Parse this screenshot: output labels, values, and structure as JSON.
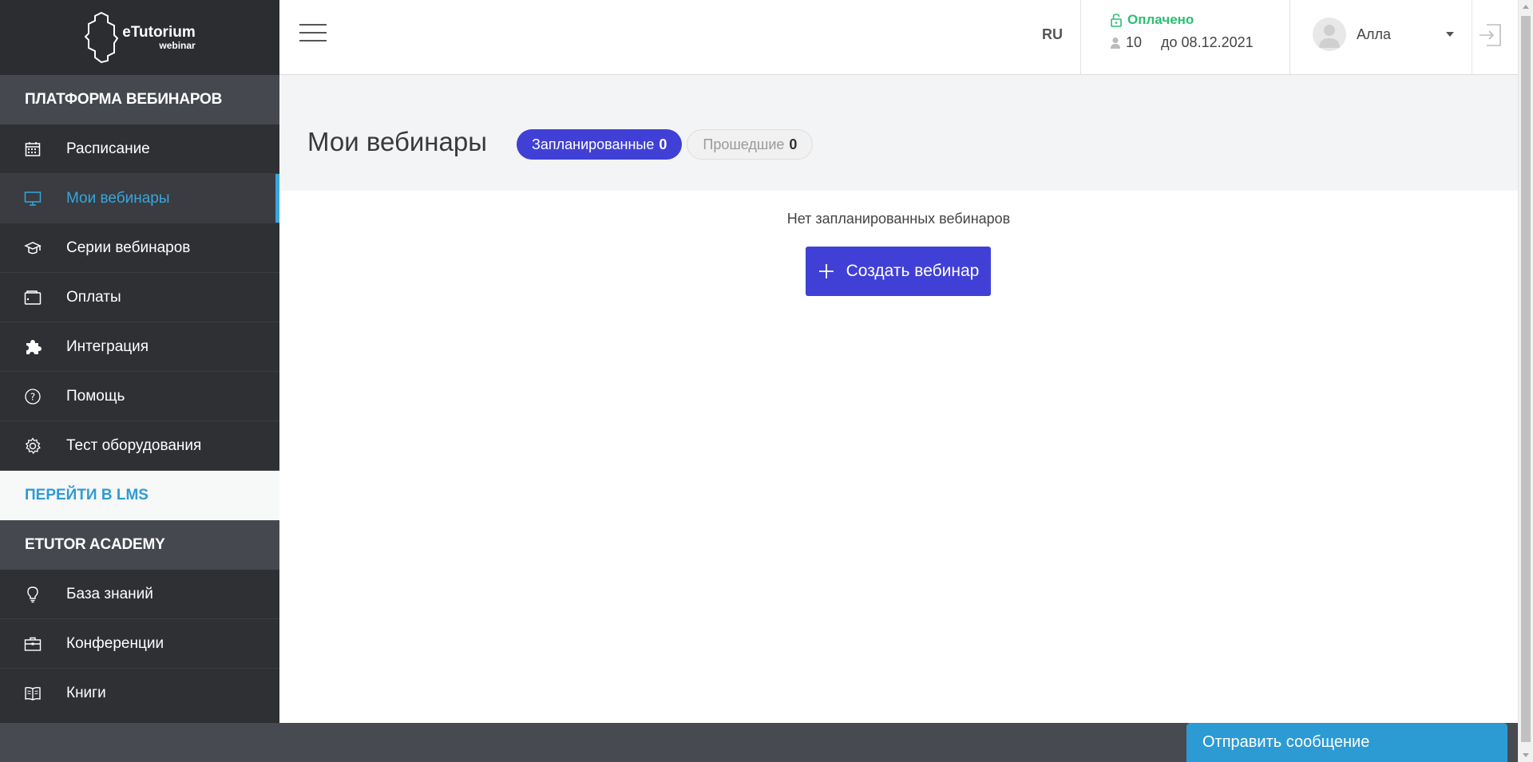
{
  "brand": {
    "logo_main": "eTutorium",
    "logo_sub": "webinar"
  },
  "sidebar": {
    "section1": "ПЛАТФОРМА ВЕБИНАРОВ",
    "items1": [
      {
        "label": "Расписание",
        "icon": "calendar-icon"
      },
      {
        "label": "Мои вебинары",
        "icon": "monitor-icon",
        "active": true
      },
      {
        "label": "Серии вебинаров",
        "icon": "graduation-cap-icon"
      },
      {
        "label": "Оплаты",
        "icon": "wallet-icon"
      },
      {
        "label": "Интеграция",
        "icon": "puzzle-icon"
      },
      {
        "label": "Помощь",
        "icon": "help-icon"
      },
      {
        "label": "Тест оборудования",
        "icon": "gear-icon"
      }
    ],
    "lms_link": "ПЕРЕЙТИ В LMS",
    "section2": "ETUTOR ACADEMY",
    "items2": [
      {
        "label": "База знаний",
        "icon": "lightbulb-icon"
      },
      {
        "label": "Конференции",
        "icon": "briefcase-icon"
      },
      {
        "label": "Книги",
        "icon": "book-icon"
      }
    ]
  },
  "header": {
    "lang": "RU",
    "plan_status": "Оплачено",
    "plan_seats": "10",
    "plan_until": "до 08.12.2021",
    "user_name": "Алла"
  },
  "main": {
    "title": "Мои вебинары",
    "tabs": [
      {
        "label": "Запланированные",
        "count": "0",
        "active": true
      },
      {
        "label": "Прошедшие",
        "count": "0",
        "active": false
      }
    ],
    "empty_message": "Нет запланированных вебинаров",
    "create_button": "Создать вебинар"
  },
  "chat": {
    "send_label": "Отправить сообщение"
  },
  "colors": {
    "sidebar_bg": "#2e3034",
    "accent": "#35a7dd",
    "primary_button": "#4040d6",
    "paid_green": "#2bbf73"
  }
}
